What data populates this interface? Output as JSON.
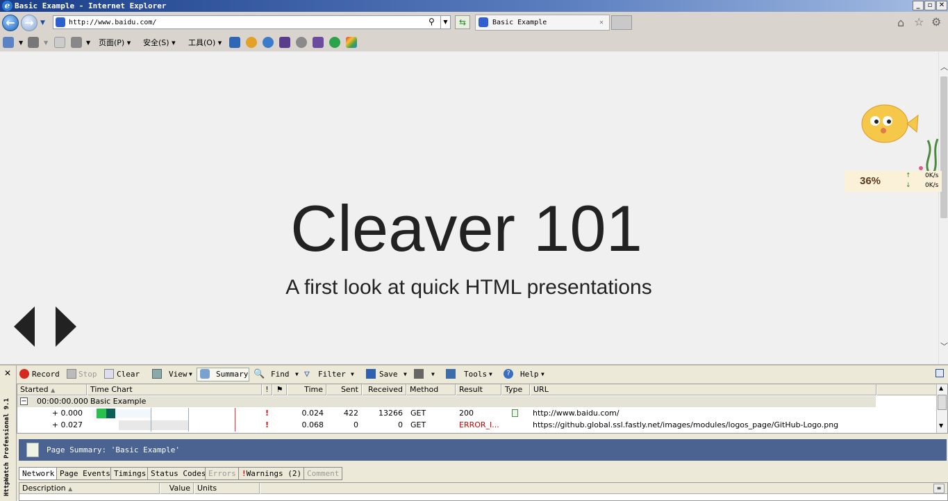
{
  "window": {
    "title": "Basic Example - Internet Explorer"
  },
  "address": {
    "url": "http://www.baidu.com/"
  },
  "tab": {
    "label": "Basic Example"
  },
  "command_bar": {
    "page": "页面(P)",
    "safety": "安全(S)",
    "tools": "工具(O)"
  },
  "slide": {
    "title": "Cleaver 101",
    "subtitle": "A first look at quick HTML presentations"
  },
  "widget": {
    "percent": "36%",
    "up": "0K/s",
    "down": "0K/s"
  },
  "httpwatch": {
    "side_label": "HttpWatch Professional 9.1",
    "toolbar": {
      "record": "Record",
      "stop": "Stop",
      "clear": "Clear",
      "view": "View",
      "summary": "Summary",
      "find": "Find",
      "filter": "Filter",
      "save": "Save",
      "tools": "Tools",
      "help": "Help"
    },
    "columns": {
      "started": "Started",
      "timechart": "Time Chart",
      "bang": "!",
      "time": "Time",
      "sent": "Sent",
      "received": "Received",
      "method": "Method",
      "result": "Result",
      "type": "Type",
      "url": "URL"
    },
    "group": {
      "started": "00:00:00.000",
      "name": "Basic Example"
    },
    "rows": [
      {
        "started": "+ 0.000",
        "warn": "!",
        "time": "0.024",
        "sent": "422",
        "received": "13266",
        "method": "GET",
        "result": "200",
        "url": "http://www.baidu.com/"
      },
      {
        "started": "+ 0.027",
        "warn": "!",
        "time": "0.068",
        "sent": "0",
        "received": "0",
        "method": "GET",
        "result": "ERROR_I...",
        "url": "https://github.global.ssl.fastly.net/images/modules/logos_page/GitHub-Logo.png"
      }
    ],
    "summary": "Page Summary:  'Basic Example'",
    "tabs": {
      "network": "Network",
      "page_events": "Page Events",
      "timings": "Timings",
      "status_codes": "Status Codes",
      "errors": "Errors",
      "warnings": "Warnings (2)",
      "comment": "Comment"
    },
    "bottom_columns": {
      "description": "Description",
      "value": "Value",
      "units": "Units"
    }
  },
  "colors": {
    "titlebar": "#1a3e8a",
    "summary_bar": "#4a6390",
    "error": "#cc0000"
  }
}
